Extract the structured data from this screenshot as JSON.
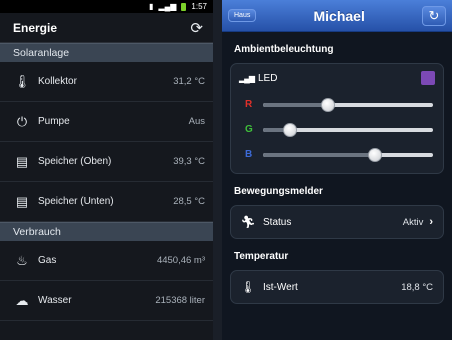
{
  "android": {
    "status": {
      "time": "1:57"
    },
    "appbar": {
      "title": "Energie",
      "refresh_icon": "refresh-icon"
    },
    "sections": [
      {
        "title": "Solaranlage"
      },
      {
        "title": "Verbrauch"
      }
    ],
    "rows": [
      {
        "label": "Kollektor",
        "value": "31,2 °C",
        "icon": "thermometer-icon"
      },
      {
        "label": "Pumpe",
        "value": "Aus",
        "icon": "power-icon"
      },
      {
        "label": "Speicher (Oben)",
        "value": "39,3 °C",
        "icon": "tank-icon"
      },
      {
        "label": "Speicher (Unten)",
        "value": "28,5 °C",
        "icon": "tank-icon"
      },
      {
        "label": "Gas",
        "value": "4450,46 m³",
        "icon": "flame-icon"
      },
      {
        "label": "Wasser",
        "value": "215368 liter",
        "icon": "water-icon"
      }
    ]
  },
  "ios": {
    "navbar": {
      "home_label": "Haus",
      "title": "Michael"
    },
    "ambient": {
      "title": "Ambientbeleuchtung",
      "led_label": "LED",
      "led_color": "#7c49b5",
      "sliders": [
        {
          "channel": "R",
          "color": "#e0302a",
          "level": 0.38
        },
        {
          "channel": "G",
          "color": "#3fbf3a",
          "level": 0.16
        },
        {
          "channel": "B",
          "color": "#3d6bd8",
          "level": 0.66
        }
      ]
    },
    "motion": {
      "title": "Bewegungsmelder",
      "status_label": "Status",
      "status_value": "Aktiv"
    },
    "temperature": {
      "title": "Temperatur",
      "label": "Ist-Wert",
      "value": "18,8 °C"
    }
  }
}
